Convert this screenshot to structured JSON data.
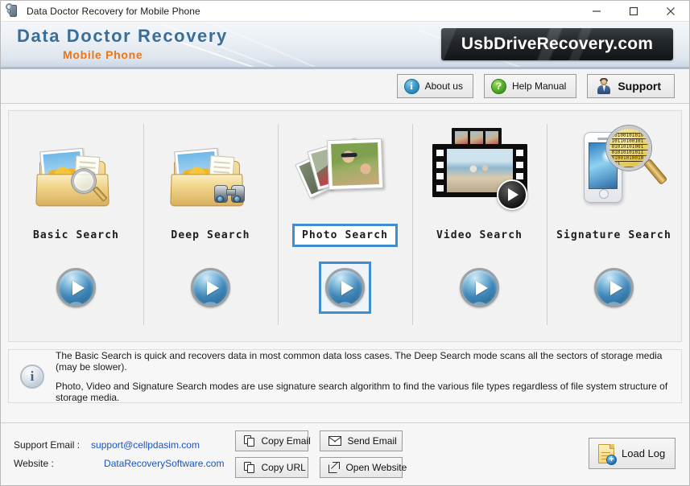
{
  "window": {
    "title": "Data Doctor Recovery for Mobile Phone",
    "app_icon": "phone-magnifier-icon",
    "minimize_label": "Minimize",
    "maximize_label": "Maximize",
    "close_label": "Close"
  },
  "brand": {
    "line1": "Data Doctor Recovery",
    "line2": "Mobile Phone",
    "site_banner": "UsbDriveRecovery.com",
    "title_color": "#3b6d99",
    "subtitle_color": "#e8751a"
  },
  "toolbar": {
    "buttons": [
      {
        "label": "About us",
        "icon": "info-icon",
        "glyph": "i"
      },
      {
        "label": "Help Manual",
        "icon": "question-icon",
        "glyph": "?"
      },
      {
        "label": "Support",
        "icon": "support-person-icon",
        "glyph": ""
      }
    ]
  },
  "modes": {
    "selected": "Photo Search",
    "selection_color": "#3f8fd0",
    "items": [
      {
        "label": "Basic Search",
        "icon": "folder-magnifier-icon",
        "selected": false
      },
      {
        "label": "Deep Search",
        "icon": "folder-binoculars-icon",
        "selected": false
      },
      {
        "label": "Photo Search",
        "icon": "photo-stack-icon",
        "selected": true
      },
      {
        "label": "Video Search",
        "icon": "film-strip-icon",
        "selected": false
      },
      {
        "label": "Signature Search",
        "icon": "phone-binary-magnifier-icon",
        "selected": false
      }
    ],
    "play_button_label": "Start"
  },
  "description": {
    "icon": "info-icon",
    "lines": [
      "The Basic Search is quick and recovers data in most common data loss cases. The Deep Search mode scans all the sectors of storage media (may be slower).",
      "Photo, Video and Signature Search modes are use signature search algorithm to find the various file types regardless of file system structure of storage media."
    ]
  },
  "footer": {
    "support_email_label": "Support Email :",
    "support_email_value": "support@cellpdasim.com",
    "website_label": "Website :",
    "website_value": "DataRecoverySoftware.com",
    "link_color": "#1a53c4",
    "buttons": {
      "copy_email": "Copy Email",
      "send_email": "Send Email",
      "copy_url": "Copy URL",
      "open_website": "Open Website",
      "load_log": "Load Log"
    }
  },
  "signature_binary": "1010010101010110100101010101010010101010101101001010010101"
}
